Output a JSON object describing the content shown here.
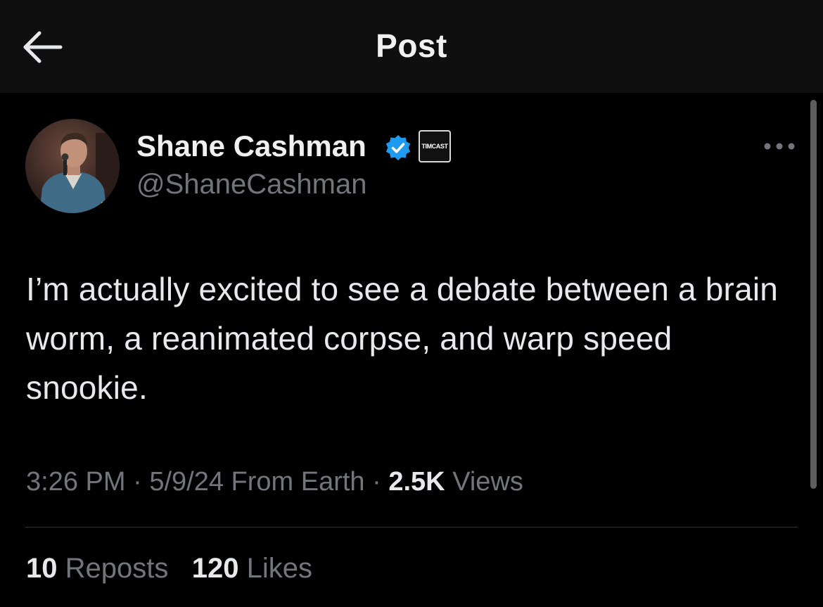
{
  "header": {
    "title": "Post",
    "back_icon": "arrow-left-icon"
  },
  "post": {
    "author": {
      "name": "Shane Cashman",
      "handle": "@ShaneCashman",
      "verified": true,
      "verified_color": "#1d9bf0",
      "affiliate_badge": "TIMCAST"
    },
    "text": "I’m actually excited to see a debate between a brain worm, a reanimated corpse, and warp speed snookie.",
    "time": "3:26 PM",
    "date": "5/9/24",
    "source": "From Earth",
    "views_count": "2.5K",
    "views_label": "Views",
    "separator": "·",
    "reposts_count": "10",
    "reposts_label": "Reposts",
    "likes_count": "120",
    "likes_label": "Likes"
  },
  "colors": {
    "background": "#000000",
    "header_background": "#0f0f0f",
    "primary_text": "#e7e9ea",
    "secondary_text": "#71767b",
    "divider": "#2f3336"
  }
}
